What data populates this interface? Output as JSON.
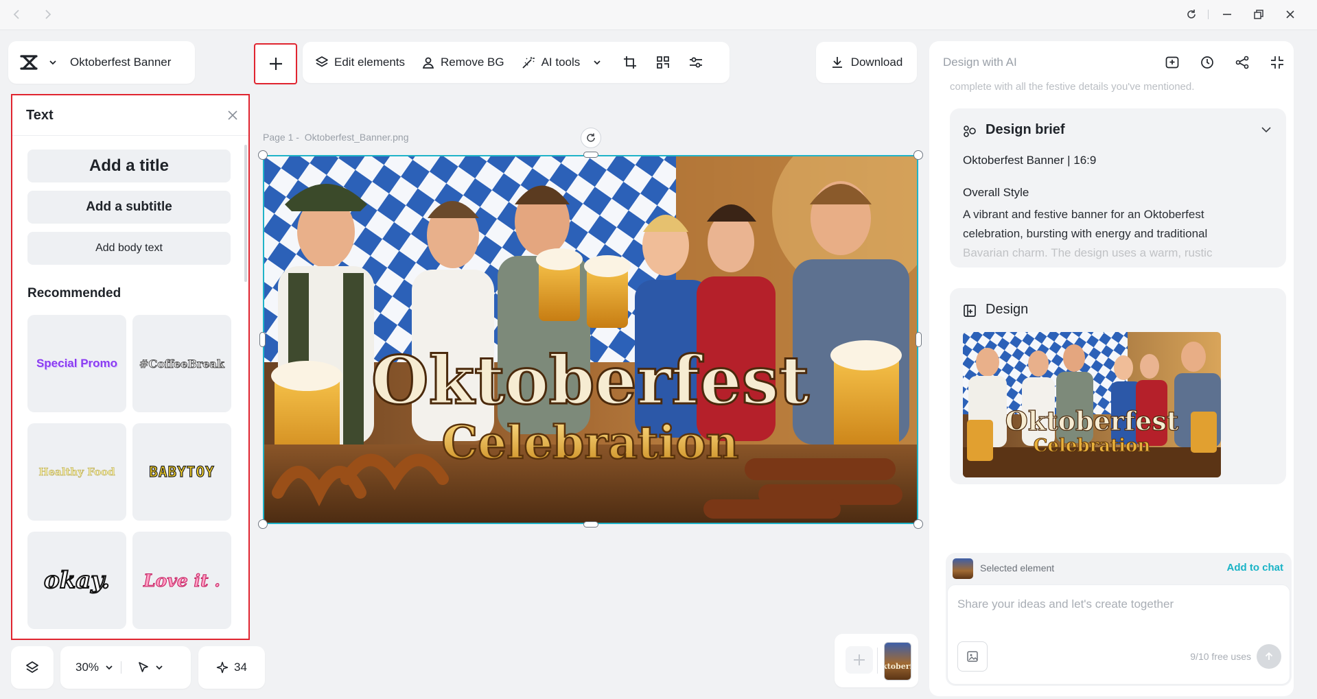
{
  "header": {
    "project_title": "Oktoberfest Banner"
  },
  "toolbar": {
    "edit_elements": "Edit elements",
    "remove_bg": "Remove BG",
    "ai_tools": "AI tools",
    "download": "Download"
  },
  "text_panel": {
    "title": "Text",
    "add_title": "Add a title",
    "add_subtitle": "Add a subtitle",
    "add_body": "Add body text",
    "recommended_label": "Recommended",
    "styles": [
      "Special Promo",
      "#CoffeeBreak",
      "Healthy Food",
      "BABYTOY",
      "okay.",
      "Love it ."
    ]
  },
  "canvas": {
    "page_label": "Page 1 -",
    "file_name": "Oktoberfest_Banner.png",
    "banner_title": "Oktoberfest",
    "banner_subtitle": "Celebration"
  },
  "bottom_bar": {
    "zoom": "30%",
    "credits": "34"
  },
  "ai_panel": {
    "header": "Design with AI",
    "faded_line": "complete with all the festive details you've mentioned.",
    "brief": {
      "title": "Design brief",
      "meta": "Oktoberfest Banner | 16:9",
      "section": "Overall Style",
      "line1": "A vibrant and festive banner for an Oktoberfest",
      "line2": "celebration, bursting with energy and traditional",
      "line3": "Bavarian charm. The design uses a warm, rustic"
    },
    "design": {
      "title": "Design",
      "thumb_title": "Oktoberfest",
      "thumb_subtitle": "Celebration"
    },
    "selected_element": "Selected element",
    "add_to_chat": "Add to chat",
    "input_placeholder": "Share your ideas and let's create together",
    "free_uses": "9/10 free uses",
    "thumb_text": "ktoberfe"
  },
  "colors": {
    "accent": "#1fb3c8",
    "highlight": "#e0242f",
    "link": "#19b3c6"
  }
}
